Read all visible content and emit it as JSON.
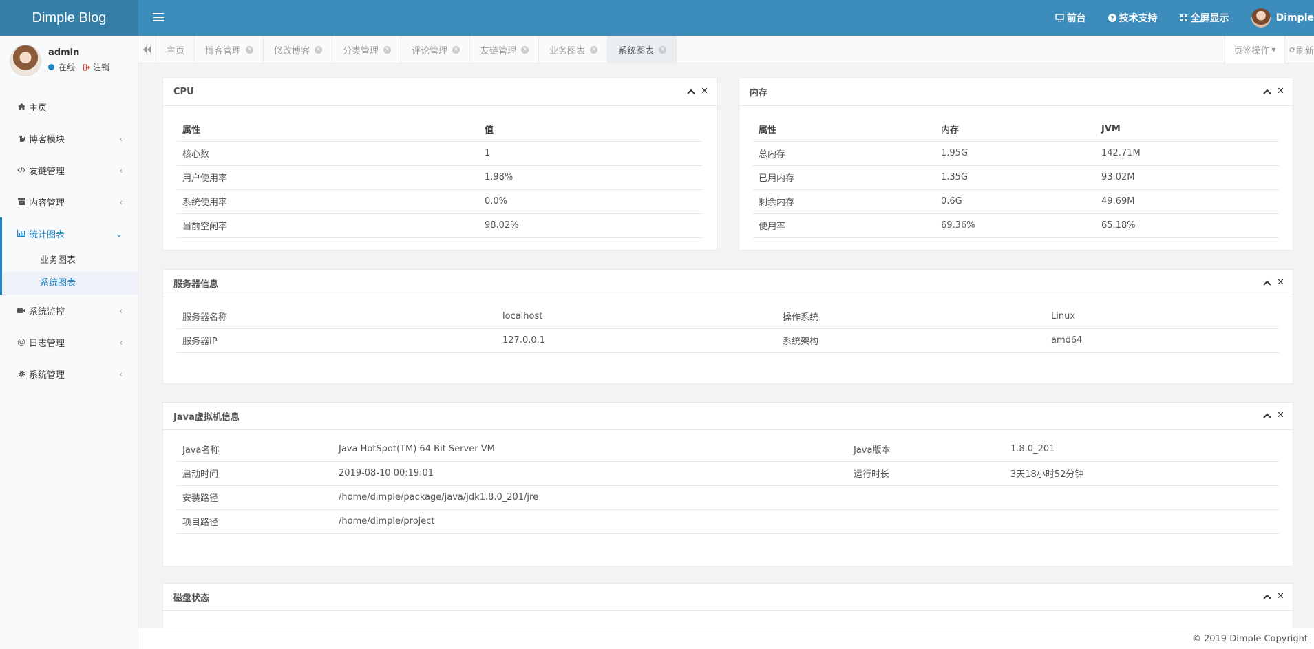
{
  "brand": {
    "title": "Dimple Blog"
  },
  "topnav": {
    "frontend": "前台",
    "support": "技术支持",
    "fullscreen": "全屏显示",
    "username": "Dimple"
  },
  "user": {
    "name": "admin",
    "status": "在线",
    "logout": "注销"
  },
  "sidebar": {
    "items": [
      {
        "label": "主页",
        "icon": "home-icon"
      },
      {
        "label": "博客模块",
        "icon": "hand-icon"
      },
      {
        "label": "友链管理",
        "icon": "code-icon"
      },
      {
        "label": "内容管理",
        "icon": "archive-icon"
      },
      {
        "label": "统计图表",
        "icon": "bar-chart-icon"
      },
      {
        "label": "系统监控",
        "icon": "video-icon"
      },
      {
        "label": "日志管理",
        "icon": "at-icon"
      },
      {
        "label": "系统管理",
        "icon": "gear-icon"
      }
    ],
    "submenu": [
      {
        "label": "业务图表"
      },
      {
        "label": "系统图表"
      }
    ]
  },
  "tabs": [
    {
      "label": "主页"
    },
    {
      "label": "博客管理"
    },
    {
      "label": "修改博客"
    },
    {
      "label": "分类管理"
    },
    {
      "label": "评论管理"
    },
    {
      "label": "友链管理"
    },
    {
      "label": "业务图表"
    },
    {
      "label": "系统图表"
    }
  ],
  "tab_actions": {
    "page_ops": "页签操作",
    "refresh": "刷新"
  },
  "cpu": {
    "title": "CPU",
    "headers": [
      "属性",
      "值"
    ],
    "rows": [
      [
        "核心数",
        "1"
      ],
      [
        "用户使用率",
        "1.98%"
      ],
      [
        "系统使用率",
        "0.0%"
      ],
      [
        "当前空闲率",
        "98.02%"
      ]
    ]
  },
  "memory": {
    "title": "内存",
    "headers": [
      "属性",
      "内存",
      "JVM"
    ],
    "rows": [
      [
        "总内存",
        "1.95G",
        "142.71M"
      ],
      [
        "已用内存",
        "1.35G",
        "93.02M"
      ],
      [
        "剩余内存",
        "0.6G",
        "49.69M"
      ],
      [
        "使用率",
        "69.36%",
        "65.18%"
      ]
    ]
  },
  "server": {
    "title": "服务器信息",
    "rows": [
      [
        "服务器名称",
        "localhost",
        "操作系统",
        "Linux"
      ],
      [
        "服务器IP",
        "127.0.0.1",
        "系统架构",
        "amd64"
      ]
    ]
  },
  "jvm": {
    "title": "Java虚拟机信息",
    "rows": [
      [
        "Java名称",
        "Java HotSpot(TM) 64-Bit Server VM",
        "Java版本",
        "1.8.0_201"
      ],
      [
        "启动时间",
        "2019-08-10 00:19:01",
        "运行时长",
        "3天18小时52分钟"
      ],
      [
        "安装路径",
        "/home/dimple/package/java/jdk1.8.0_201/jre",
        "",
        ""
      ],
      [
        "项目路径",
        "/home/dimple/project",
        "",
        ""
      ]
    ]
  },
  "disk": {
    "title": "磁盘状态"
  },
  "footer": {
    "copyright": "© 2019 Dimple Copyright"
  }
}
